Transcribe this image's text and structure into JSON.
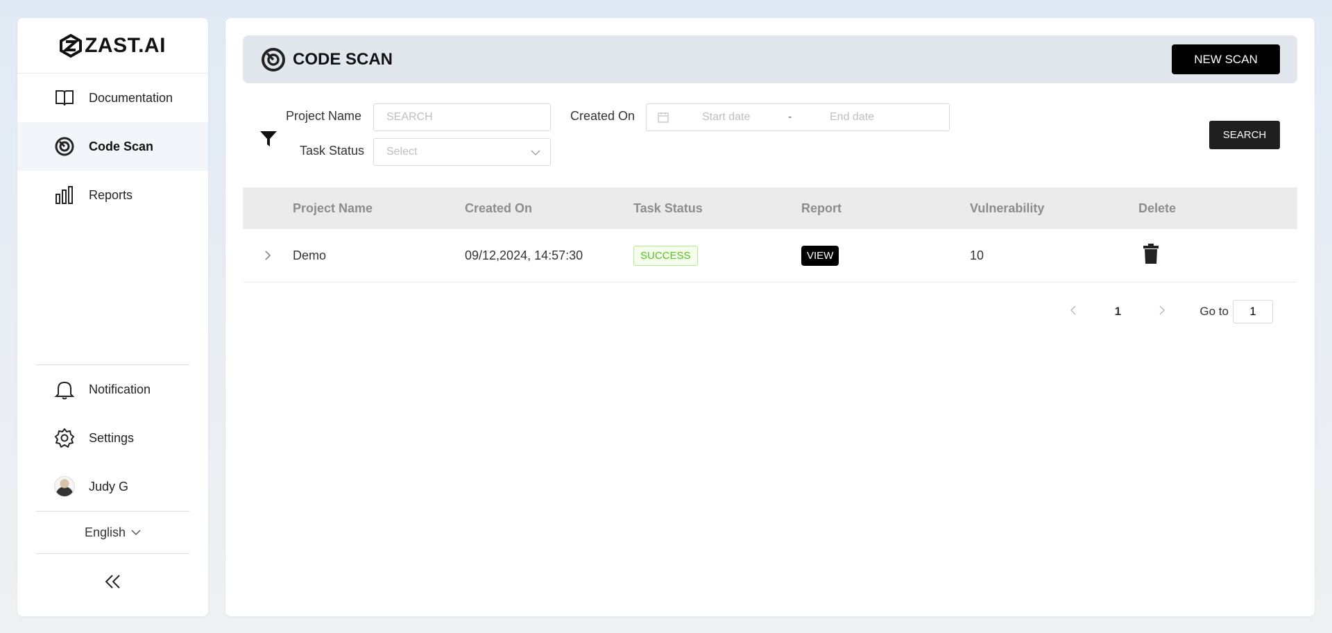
{
  "brand": {
    "name": "ZAST.AI"
  },
  "sidebar": {
    "items": [
      {
        "label": "Documentation",
        "icon": "book-icon"
      },
      {
        "label": "Code Scan",
        "icon": "scan-icon",
        "active": true
      },
      {
        "label": "Reports",
        "icon": "bar-chart-icon"
      }
    ],
    "bottom": [
      {
        "label": "Notification",
        "icon": "bell-icon"
      },
      {
        "label": "Settings",
        "icon": "gear-icon"
      },
      {
        "label": "Judy G",
        "icon": "avatar"
      }
    ],
    "language": "English"
  },
  "header": {
    "title": "CODE SCAN",
    "new_scan_label": "NEW SCAN"
  },
  "filters": {
    "project_name_label": "Project Name",
    "project_name_placeholder": "SEARCH",
    "created_on_label": "Created On",
    "start_placeholder": "Start date",
    "date_separator": "-",
    "end_placeholder": "End date",
    "task_status_label": "Task Status",
    "task_status_placeholder": "Select",
    "search_label": "SEARCH"
  },
  "table": {
    "columns": [
      "Project Name",
      "Created On",
      "Task Status",
      "Report",
      "Vulnerability",
      "Delete"
    ],
    "rows": [
      {
        "project": "Demo",
        "created": "09/12,2024, 14:57:30",
        "status": "SUCCESS",
        "report": "VIEW",
        "vulnerability": "10"
      }
    ]
  },
  "pagination": {
    "current": "1",
    "goto_label": "Go to",
    "goto_value": "1"
  },
  "colors": {
    "accent": "#000000",
    "success": "#52c41a",
    "header_bg": "#e2e7ee"
  }
}
